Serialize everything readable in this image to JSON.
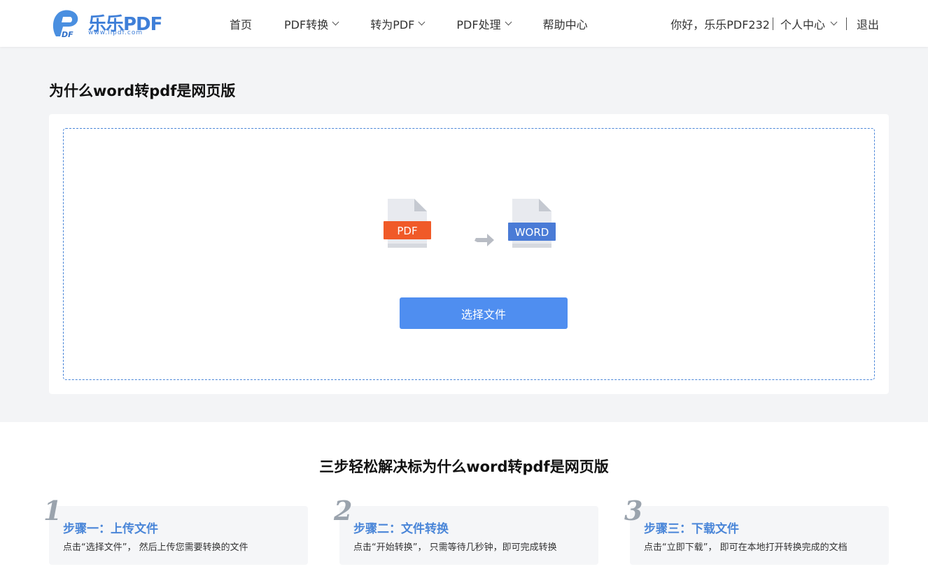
{
  "header": {
    "logo_text": "乐乐PDF",
    "logo_url": "www.llpdf.com",
    "nav": [
      {
        "label": "首页",
        "has_dropdown": false
      },
      {
        "label": "PDF转换",
        "has_dropdown": true
      },
      {
        "label": "转为PDF",
        "has_dropdown": true
      },
      {
        "label": "PDF处理",
        "has_dropdown": true
      },
      {
        "label": "帮助中心",
        "has_dropdown": false
      }
    ],
    "greeting": "你好，乐乐PDF232",
    "user_center": "个人中心",
    "logout": "退出"
  },
  "page_title": "为什么word转pdf是网页版",
  "converter": {
    "from_label": "PDF",
    "to_label": "WORD",
    "choose_button": "选择文件"
  },
  "steps_section": {
    "title": "三步轻松解决标为什么word转pdf是网页版",
    "steps": [
      {
        "num": "1",
        "title": "步骤一：上传文件",
        "desc": "点击“选择文件”， 然后上传您需要转换的文件"
      },
      {
        "num": "2",
        "title": "步骤二：文件转换",
        "desc": "点击“开始转换”， 只需等待几秒钟，即可完成转换"
      },
      {
        "num": "3",
        "title": "步骤三：下载文件",
        "desc": "点击“立即下载”， 即可在本地打开转换完成的文档"
      }
    ]
  },
  "colors": {
    "accent": "#4f8ef0",
    "pdf_red": "#f05a28",
    "word_blue": "#4a7bd6"
  },
  "icons": {
    "arrow": "arrow-right-icon",
    "dropdown": "chevron-down-icon"
  }
}
